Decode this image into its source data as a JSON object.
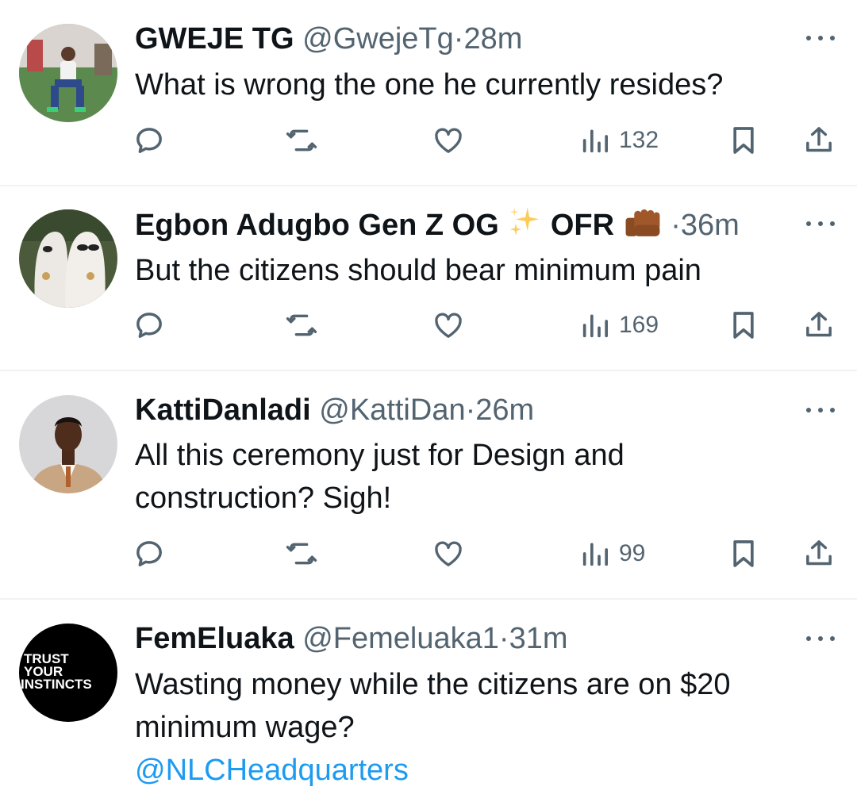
{
  "tweets": [
    {
      "name": "GWEJE TG",
      "handle": "@GwejeTg",
      "time": "28m",
      "text": "What is wrong the one he currently resides?",
      "views": "132",
      "avatar": "person-sitting-photo"
    },
    {
      "name": "Egbon Adugbo Gen Z OG",
      "name_suffix": "OFR",
      "handle": "",
      "time": "36m",
      "text": "But the citizens should bear minimum pain",
      "views": "169",
      "avatar": "ghost-costumes-photo",
      "emojis": [
        "sparkles-icon",
        "raised-fist-icon"
      ]
    },
    {
      "name": "KattiDanladi",
      "handle": "@KattiDan",
      "time": "26m",
      "text_lines": [
        "All this ceremony just for Design and",
        "construction? Sigh!"
      ],
      "views": "99",
      "avatar": "man-in-suit-photo"
    },
    {
      "name": "FemEluaka",
      "handle": "@Femeluaka1",
      "time": "31m",
      "text_lines": [
        "Wasting money while the citizens are on $20",
        "minimum wage?"
      ],
      "mention": "@NLCHeadquarters",
      "avatar_text": [
        "TRUST",
        "YOUR",
        "INSTINCTS"
      ]
    }
  ],
  "separator": "·",
  "colors": {
    "text": "#0f1419",
    "secondary": "#536471",
    "link": "#1d9bf0",
    "divider": "#eff3f4"
  }
}
